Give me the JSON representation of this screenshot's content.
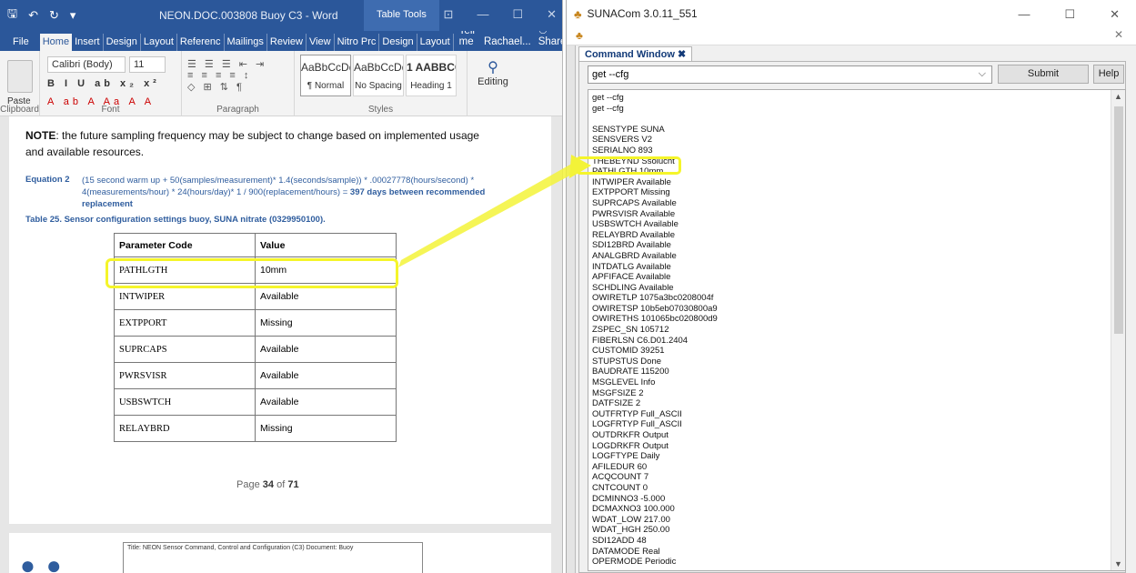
{
  "word": {
    "title": "NEON.DOC.003808 Buoy C3 - Word",
    "context_tab": "Table Tools",
    "tabs": [
      "File",
      "Home",
      "Insert",
      "Design",
      "Layout",
      "Referenc",
      "Mailings",
      "Review",
      "View",
      "Nitro Prc",
      "Design",
      "Layout"
    ],
    "tell_me": "Tell me",
    "user": "Rachael...",
    "share": "Share",
    "ribbon": {
      "paste": "Paste",
      "font_name": "Calibri (Body)",
      "font_size": "11",
      "styles": [
        {
          "preview": "AaBbCcDd",
          "name": "¶ Normal"
        },
        {
          "preview": "AaBbCcDd",
          "name": "No Spacing"
        },
        {
          "preview": "1 AABBCC",
          "name": "Heading 1"
        }
      ],
      "editing": "Editing",
      "groups": [
        "Clipboard",
        "Font",
        "Paragraph",
        "Styles"
      ]
    },
    "document": {
      "note_bold": "NOTE",
      "note_text": ": the future sampling frequency may be subject to change based on implemented usage and available resources.",
      "equation_label": "Equation 2",
      "equation_text": "(15 second warm up + 50(samples/measurement)* 1.4(seconds/sample)) * .00027778(hours/second) * 4(measurements/hour) * 24(hours/day)* 1 / 900(replacement/hours) = ",
      "equation_result": "397 days between recommended replacement",
      "table_title": "Table 25. Sensor configuration settings buoy, SUNA nitrate (0329950100).",
      "table_header": [
        "Parameter Code",
        "Value"
      ],
      "table_rows": [
        [
          "PATHLGTH",
          "10mm"
        ],
        [
          "INTWIPER",
          "Available"
        ],
        [
          "EXTPPORT",
          "Missing"
        ],
        [
          "SUPRCAPS",
          "Available"
        ],
        [
          "PWRSVISR",
          "Available"
        ],
        [
          "USBSWTCH",
          "Available"
        ],
        [
          "RELAYBRD",
          "Missing"
        ]
      ],
      "page_label": "Page",
      "page_current": "34",
      "page_of": "of",
      "page_total": "71",
      "footer_text": "Title: NEON Sensor Command, Control and Configuration (C3) Document: Buoy"
    }
  },
  "suna": {
    "title": "SUNACom 3.0.11_551",
    "tab": "Command Window",
    "command": "get --cfg",
    "submit": "Submit",
    "help": "Help",
    "output": [
      "get --cfg",
      "get --cfg",
      "",
      "SENSTYPE SUNA",
      "SENSVERS V2",
      "SERIALNO 893",
      "THEBEYND Ssolucht",
      "PATHLGTH 10mm",
      "INTWIPER Available",
      "EXTPPORT Missing",
      "SUPRCAPS Available",
      "PWRSVISR Available",
      "USBSWTCH Available",
      "RELAYBRD Available",
      "SDI12BRD Available",
      "ANALGBRD Available",
      "INTDATLG Available",
      "APFIFACE Available",
      "SCHDLING Available",
      "OWIRETLP 1075a3bc0208004f",
      "OWIRETSP 10b5eb07030800a9",
      "OWIRETHS 101065bc020800d9",
      "ZSPEC_SN 105712",
      "FIBERLSN C6.D01.2404",
      "CUSTOMID 39251",
      "STUPSTUS Done",
      "BAUDRATE 115200",
      "MSGLEVEL Info",
      "MSGFSIZE 2",
      "DATFSIZE 2",
      "OUTFRTYP Full_ASCII",
      "LOGFRTYP Full_ASCII",
      "OUTDRKFR Output",
      "LOGDRKFR Output",
      "LOGFTYPE Daily",
      "AFILEDUR 60",
      "ACQCOUNT 7",
      "CNTCOUNT 0",
      "DCMINNO3 -5.000",
      "DCMAXNO3 100.000",
      "WDAT_LOW 217.00",
      "WDAT_HGH 250.00",
      "SDI12ADD 48",
      "DATAMODE Real",
      "OPERMODE Periodic"
    ]
  }
}
